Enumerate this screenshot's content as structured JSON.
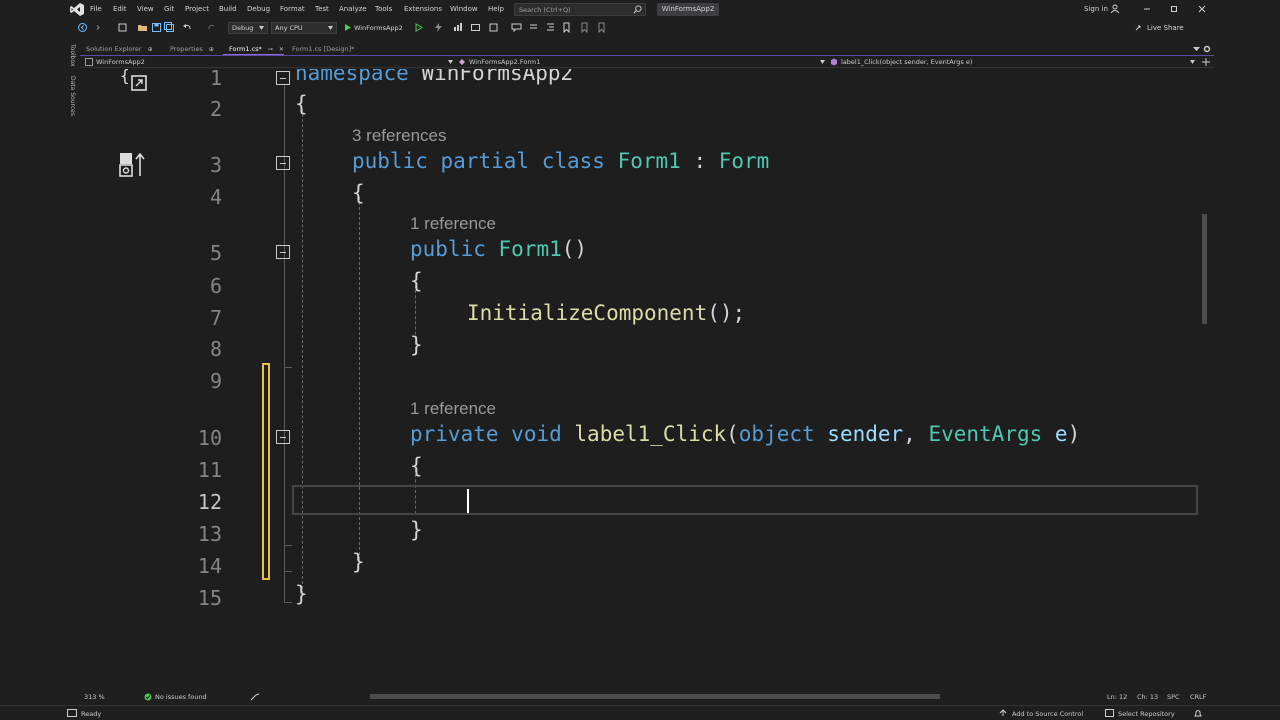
{
  "app": {
    "title": "WinFormsApp2",
    "colors": {
      "accent": "#8b6bd9",
      "keyword": "#569cd6",
      "type": "#4ec9b0",
      "method": "#dcdcaa",
      "param": "#9cdcfe",
      "changebar": "#e5c04d"
    }
  },
  "menu": {
    "items": [
      "File",
      "Edit",
      "View",
      "Git",
      "Project",
      "Build",
      "Debug",
      "Format",
      "Test",
      "Analyze",
      "Tools",
      "Extensions",
      "Window",
      "Help"
    ],
    "search_placeholder": "Search (Ctrl+Q)",
    "sign_in": "Sign in"
  },
  "toolbar": {
    "config": "Debug",
    "platform": "Any CPU",
    "run_target": "WinFormsApp2",
    "live_share": "Live Share"
  },
  "rail": {
    "toolbox": "Toolbox",
    "data_sources": "Data Sources"
  },
  "tabs": {
    "solution_explorer": "Solution Explorer",
    "properties": "Properties",
    "form_cs": "Form1.cs*",
    "form_design": "Form1.cs [Design]*"
  },
  "navbar": {
    "project": "WinFormsApp2",
    "class": "WinFormsApp2.Form1",
    "member": "label1_Click(object sender, EventArgs e)"
  },
  "editor": {
    "line_numbers": [
      "1",
      "2",
      "3",
      "4",
      "5",
      "6",
      "7",
      "8",
      "9",
      "10",
      "11",
      "12",
      "13",
      "14",
      "15"
    ],
    "refs": {
      "class_refs": "3 references",
      "ctor_refs": "1 reference",
      "click_refs": "1 reference"
    },
    "tokens": {
      "namespace_kw": "namespace",
      "namespace_name": "WinFormsApp2",
      "public_kw": "public",
      "partial_kw": "partial",
      "class_kw": "class",
      "form1": "Form1",
      "colon": ":",
      "form": "Form",
      "ctor_name": "Form1",
      "ctor_parens": "()",
      "init_call": "InitializeComponent",
      "init_tail": "();",
      "private_kw": "private",
      "void_kw": "void",
      "method_name": "label1_Click",
      "open_paren": "(",
      "object_kw": "object",
      "sender": "sender",
      "comma": ",",
      "eventargs": "EventArgs",
      "e": "e",
      "close_paren": ")",
      "brace_open": "{",
      "brace_close": "}"
    }
  },
  "editor_status": {
    "zoom": "313 %",
    "issues": "No issues found",
    "line": "Ln: 12",
    "col": "Ch: 13",
    "spc": "SPC",
    "crlf": "CRLF"
  },
  "statusbar": {
    "ready": "Ready",
    "source_control": "Add to Source Control",
    "repository": "Select Repository"
  }
}
